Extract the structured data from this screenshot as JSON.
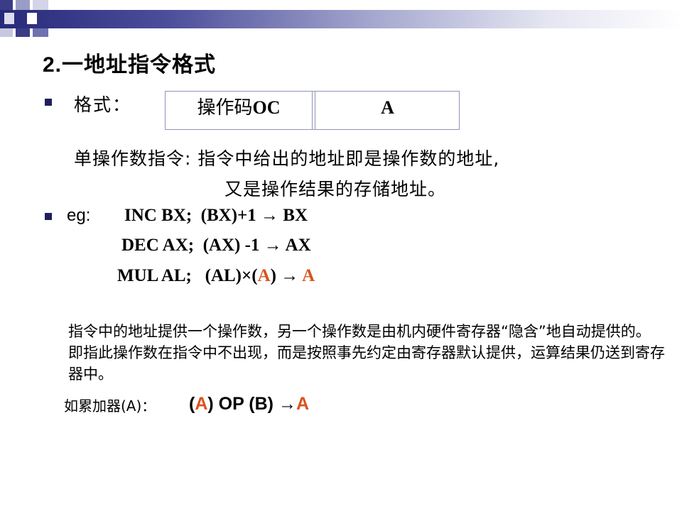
{
  "slide": {
    "title_num": "2.",
    "title_text": "一地址指令格式",
    "format_label": "格式：",
    "format_table": {
      "opcode_cell_cn": "操作码",
      "opcode_cell_en": "OC",
      "address_cell": "A"
    },
    "description_line1": "单操作数指令: 指令中给出的地址即是操作数的地址,",
    "description_line2": "又是操作结果的存储地址。",
    "eg_label": "eg:",
    "examples": [
      {
        "prefix": "INC BX;  (BX)+1 ",
        "arrow": "→",
        "suffix": " BX"
      },
      {
        "prefix": "DEC AX;  (AX) -1 ",
        "arrow": "→",
        "suffix": " AX"
      },
      {
        "prefix": "MUL AL;   (AL)×(",
        "highlight1": "A",
        "mid": ") ",
        "arrow": "→",
        "highlight2": " A"
      }
    ],
    "paragraph": "指令中的地址提供一个操作数，另一个操作数是由机内硬件寄存器“隐含”地自动提供的。即指此操作数在指令中不出现，而是按照事先约定由寄存器默认提供，运算结果仍送到寄存器中。",
    "accumulator_label": "如累加器(A)：",
    "accumulator_expr": {
      "open": "(",
      "a1": "A",
      "middle": ") OP (B) ",
      "arrow": "→",
      "a2": "A"
    }
  },
  "colors": {
    "highlight": "#d9541e",
    "bullet": "#1f1f5c",
    "header_dark": "#27297a"
  }
}
